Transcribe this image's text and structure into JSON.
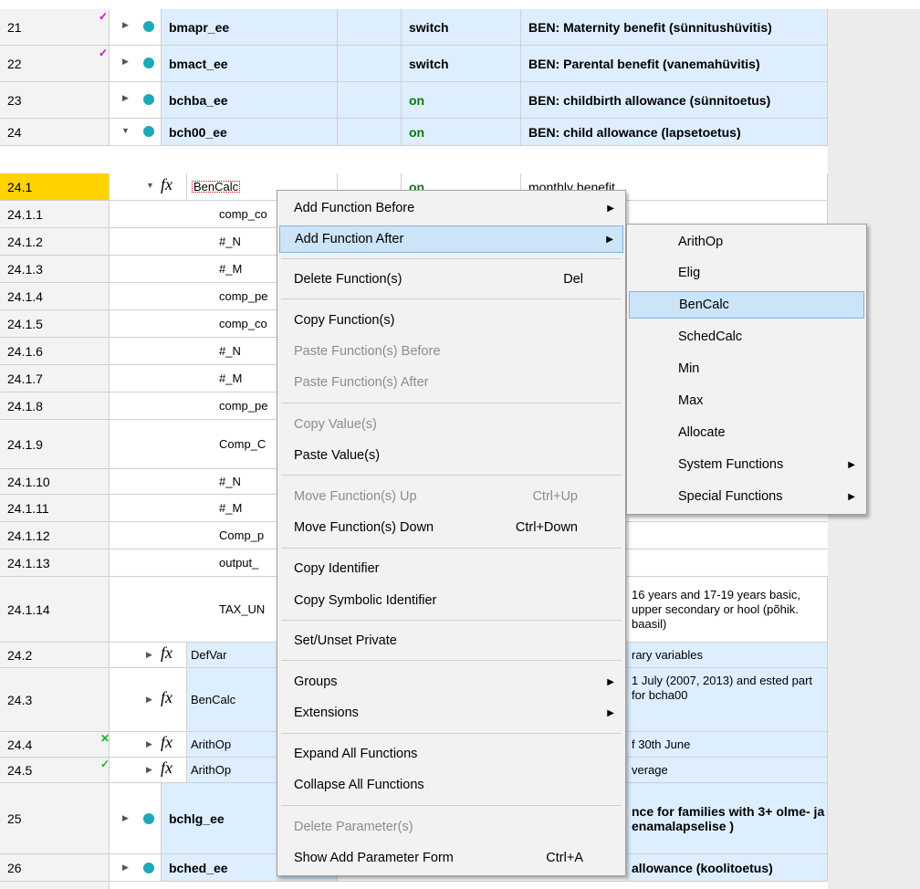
{
  "rows": [
    {
      "num": "21",
      "name": "bmapr_ee",
      "switch": "switch",
      "comment": "BEN: Maternity benefit (sünnitushüvitis)"
    },
    {
      "num": "22",
      "name": "bmact_ee",
      "switch": "switch",
      "comment": "BEN: Parental benefit (vanemahüvitis)"
    },
    {
      "num": "23",
      "name": "bchba_ee",
      "switch": "on",
      "comment": "BEN: childbirth allowance (sünnitoetus)"
    },
    {
      "num": "24",
      "name": "bch00_ee",
      "switch": "on",
      "comment": "BEN: child allowance (lapsetoetus)"
    },
    {
      "num": "24.1",
      "name": "BenCalc",
      "switch": "on",
      "comment": "monthly benefit"
    },
    {
      "num": "24.1.1",
      "name": "comp_co",
      "comment": "t child"
    },
    {
      "num": "24.1.2",
      "name": "#_N"
    },
    {
      "num": "24.1.3",
      "name": "#_M"
    },
    {
      "num": "24.1.4",
      "name": "comp_pe"
    },
    {
      "num": "24.1.5",
      "name": "comp_co"
    },
    {
      "num": "24.1.6",
      "name": "#_N"
    },
    {
      "num": "24.1.7",
      "name": "#_M"
    },
    {
      "num": "24.1.8",
      "name": "comp_pe"
    },
    {
      "num": "24.1.9",
      "name": "Comp_C"
    },
    {
      "num": "24.1.10",
      "name": "#_N"
    },
    {
      "num": "24.1.11",
      "name": "#_M"
    },
    {
      "num": "24.1.12",
      "name": "Comp_p"
    },
    {
      "num": "24.1.13",
      "name": "output_"
    },
    {
      "num": "24.1.14",
      "name": "TAX_UN",
      "comment": "16 years and 17-19 years basic, upper secondary or hool (põhik. baasil)"
    },
    {
      "num": "24.2",
      "name": "DefVar",
      "comment": "rary variables"
    },
    {
      "num": "24.3",
      "name": "BenCalc",
      "comment": "1 July (2007, 2013) and ested part for bcha00"
    },
    {
      "num": "24.4",
      "name": "ArithOp",
      "comment": "f 30th June"
    },
    {
      "num": "24.5",
      "name": "ArithOp",
      "comment": "verage"
    },
    {
      "num": "25",
      "name": "bchlg_ee",
      "comment": "nce for families with 3+ olme- ja enamalapselise )"
    },
    {
      "num": "26",
      "name": "bched_ee",
      "comment": "allowance (koolitoetus)"
    }
  ],
  "context_menu": {
    "items": [
      {
        "label": "Add Function Before"
      },
      {
        "label": "Add Function After"
      },
      {
        "label": "Delete Function(s)",
        "shortcut": "Del"
      },
      {
        "label": "Copy Function(s)"
      },
      {
        "label": "Paste Function(s) Before"
      },
      {
        "label": "Paste Function(s) After"
      },
      {
        "label": "Copy Value(s)"
      },
      {
        "label": "Paste Value(s)"
      },
      {
        "label": "Move Function(s) Up",
        "shortcut": "Ctrl+Up"
      },
      {
        "label": "Move Function(s) Down",
        "shortcut": "Ctrl+Down"
      },
      {
        "label": "Copy Identifier"
      },
      {
        "label": "Copy Symbolic Identifier"
      },
      {
        "label": "Set/Unset Private"
      },
      {
        "label": "Groups"
      },
      {
        "label": "Extensions"
      },
      {
        "label": "Expand All Functions"
      },
      {
        "label": "Collapse All Functions"
      },
      {
        "label": "Delete Parameter(s)"
      },
      {
        "label": "Show Add Parameter Form",
        "shortcut": "Ctrl+A"
      }
    ]
  },
  "submenu": {
    "items": [
      {
        "label": "ArithOp"
      },
      {
        "label": "Elig"
      },
      {
        "label": "BenCalc"
      },
      {
        "label": "SchedCalc"
      },
      {
        "label": "Min"
      },
      {
        "label": "Max"
      },
      {
        "label": "Allocate"
      },
      {
        "label": "System Functions"
      },
      {
        "label": "Special Functions"
      }
    ]
  },
  "icons": {
    "fx": "fx",
    "on_color": "#0a7a0a",
    "selected_color": "#ffd200",
    "hover_color": "#cce4f7"
  }
}
